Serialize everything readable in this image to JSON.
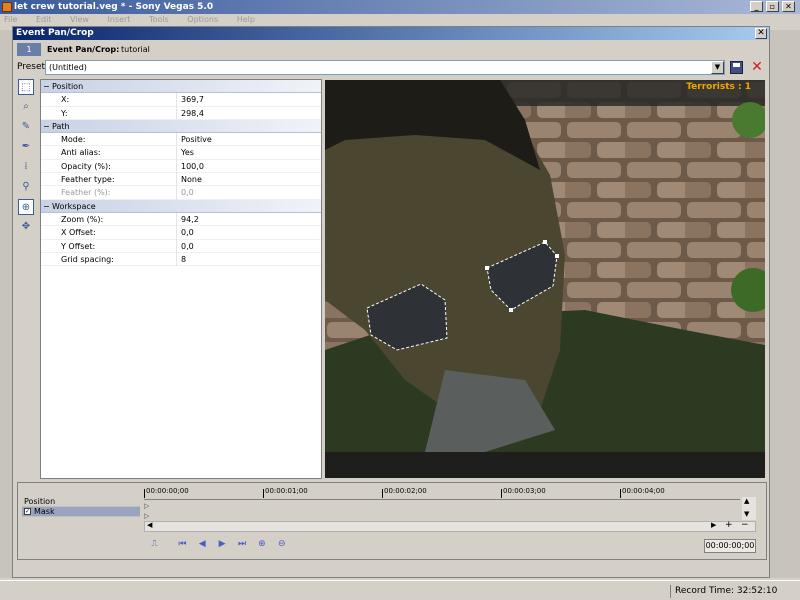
{
  "app": {
    "title": "let crew tutorial.veg * - Sony Vegas 5.0",
    "menu": [
      "File",
      "Edit",
      "View",
      "Insert",
      "Tools",
      "Options",
      "Help"
    ],
    "window_controls": [
      "_",
      "▫",
      "✕"
    ]
  },
  "dialog": {
    "title": "Event Pan/Crop",
    "header_icon": "1",
    "header_label": "Event Pan/Crop:",
    "header_name": "tutorial",
    "preset_label": "Preset:",
    "preset_value": "(Untitled)",
    "close": "✕"
  },
  "properties": [
    {
      "category": "Position",
      "toggle": "−",
      "rows": [
        {
          "name": "X:",
          "value": "369,7"
        },
        {
          "name": "Y:",
          "value": "298,4"
        }
      ]
    },
    {
      "category": "Path",
      "toggle": "−",
      "rows": [
        {
          "name": "Mode:",
          "value": "Positive"
        },
        {
          "name": "Anti alias:",
          "value": "Yes"
        },
        {
          "name": "Opacity (%):",
          "value": "100,0"
        },
        {
          "name": "Feather type:",
          "value": "None"
        },
        {
          "name": "Feather (%):",
          "value": "0,0",
          "disabled": true
        }
      ]
    },
    {
      "category": "Workspace",
      "toggle": "−",
      "rows": [
        {
          "name": "Zoom (%):",
          "value": "94,2"
        },
        {
          "name": "X Offset:",
          "value": "0,0"
        },
        {
          "name": "Y Offset:",
          "value": "0,0"
        },
        {
          "name": "Grid spacing:",
          "value": "8"
        }
      ]
    }
  ],
  "preview": {
    "overlay_text": "Terrorists : 1",
    "overlay_color": "#f0a800"
  },
  "timeline": {
    "tracks": [
      {
        "label": "Position",
        "selected": false
      },
      {
        "label": "Mask",
        "selected": true,
        "checked": true
      }
    ],
    "ruler_marks": [
      "00:00:00;00",
      "00:00:01;00",
      "00:00:02;00",
      "00:00:03;00",
      "00:00:04;00"
    ],
    "timecode": "00:00:00;00"
  },
  "status": {
    "record_time": "Record Time: 32:52:10"
  },
  "colors": {
    "title_active": "#0a246a",
    "mask_edge": "#ffffff",
    "delete": "#d02020"
  }
}
